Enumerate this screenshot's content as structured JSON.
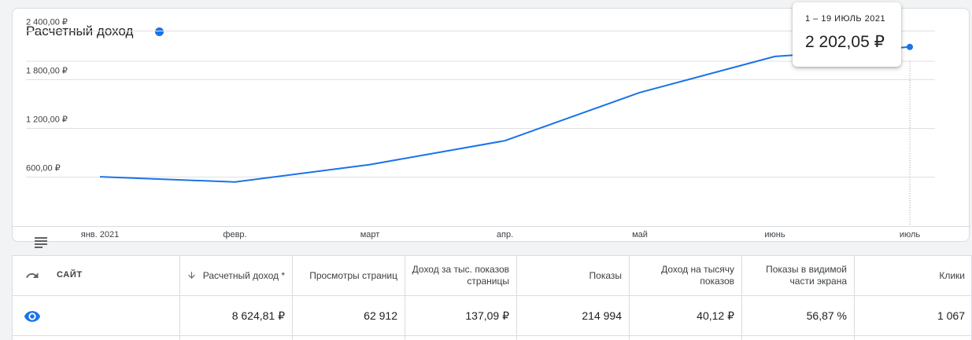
{
  "chart_card": {
    "title": "Расчетный доход",
    "accent_color": "#1a73e8",
    "tooltip": {
      "date": "1 – 19 ИЮЛЬ 2021",
      "value": "2 202,05 ₽"
    },
    "legend_icon": "list-lines-icon"
  },
  "chart_data": {
    "type": "line",
    "categories": [
      "янв. 2021",
      "февр.",
      "март",
      "апр.",
      "май",
      "июнь",
      "июль"
    ],
    "series": [
      {
        "values": [
          600,
          535,
          750,
          1045,
          1640,
          2085,
          2202.05
        ]
      }
    ],
    "y_ticks": [
      {
        "value": 600,
        "label": "600,00 ₽"
      },
      {
        "value": 1200,
        "label": "1 200,00 ₽"
      },
      {
        "value": 1800,
        "label": "1 800,00 ₽"
      },
      {
        "value": 2400,
        "label": "2 400,00 ₽"
      }
    ],
    "ylim": [
      0,
      2520
    ],
    "grid": true,
    "line_color": "#1a73e8",
    "highlight_index": 6
  },
  "table": {
    "undo_icon": "undo-icon",
    "sort_icon": "arrow-down-icon",
    "row_icon": "eye-icon",
    "site_header": "САЙТ",
    "columns": [
      "Расчетный доход *",
      "Просмотры страниц",
      "Доход за тыс. показов страницы",
      "Показы",
      "Доход на тысячу показов",
      "Показы в видимой части экрана",
      "Клики"
    ],
    "rows": [
      {
        "site": "",
        "values": [
          "8 624,81 ₽",
          "62 912",
          "137,09 ₽",
          "214 994",
          "40,12 ₽",
          "56,87 %",
          "1 067"
        ]
      }
    ]
  }
}
